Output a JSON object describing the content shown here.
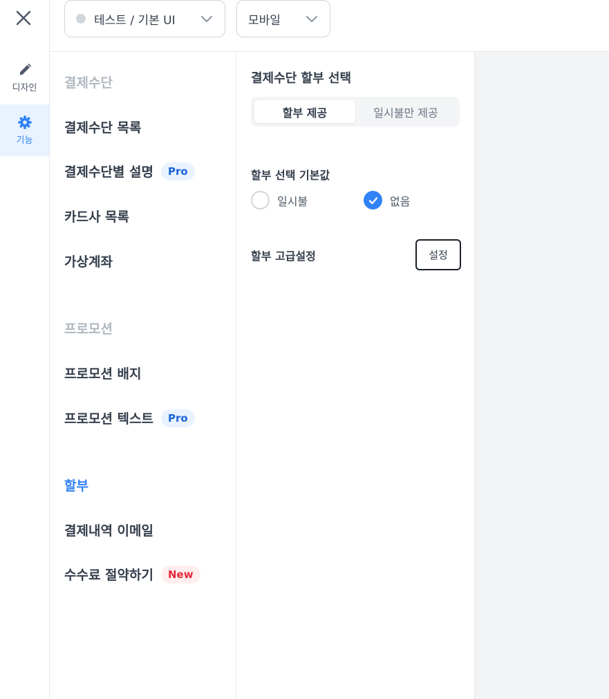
{
  "rail": {
    "close_icon": "close-icon",
    "items": [
      {
        "label": "디자인",
        "icon": "pencil-icon",
        "active": false
      },
      {
        "label": "기능",
        "icon": "gear-icon",
        "active": true
      }
    ]
  },
  "topbar": {
    "environment_select": {
      "value": "테스트 / 기본 UI",
      "status_dot_color": "#d1d6db"
    },
    "device_select": {
      "value": "모바일"
    }
  },
  "menu": {
    "sections": [
      {
        "title": "결제수단",
        "items": [
          {
            "label": "결제수단 목록"
          },
          {
            "label": "결제수단별 설명",
            "badge": "Pro"
          },
          {
            "label": "카드사 목록"
          },
          {
            "label": "가상계좌"
          }
        ]
      },
      {
        "title": "프로모션",
        "items": [
          {
            "label": "프로모션 배지"
          },
          {
            "label": "프로모션 텍스트",
            "badge": "Pro"
          }
        ]
      },
      {
        "title": "",
        "items": [
          {
            "label": "할부",
            "active": true
          },
          {
            "label": "결제내역 이메일"
          },
          {
            "label": "수수료 절약하기",
            "badge": "New"
          }
        ]
      }
    ]
  },
  "detail": {
    "title": "결제수단 할부 선택",
    "segment": {
      "options": [
        "할부 제공",
        "일시불만 제공"
      ],
      "selected": "할부 제공"
    },
    "default_label": "할부 선택 기본값",
    "radios": [
      {
        "label": "일시불",
        "checked": false
      },
      {
        "label": "없음",
        "checked": true
      }
    ],
    "advanced_label": "할부 고급설정",
    "advanced_button": "설정"
  },
  "colors": {
    "accent": "#3182f6",
    "accent_bg": "#e8f3ff",
    "new_badge_text": "#e42939",
    "new_badge_bg": "#ffeeee",
    "preview_bg": "#f2f4f6"
  }
}
